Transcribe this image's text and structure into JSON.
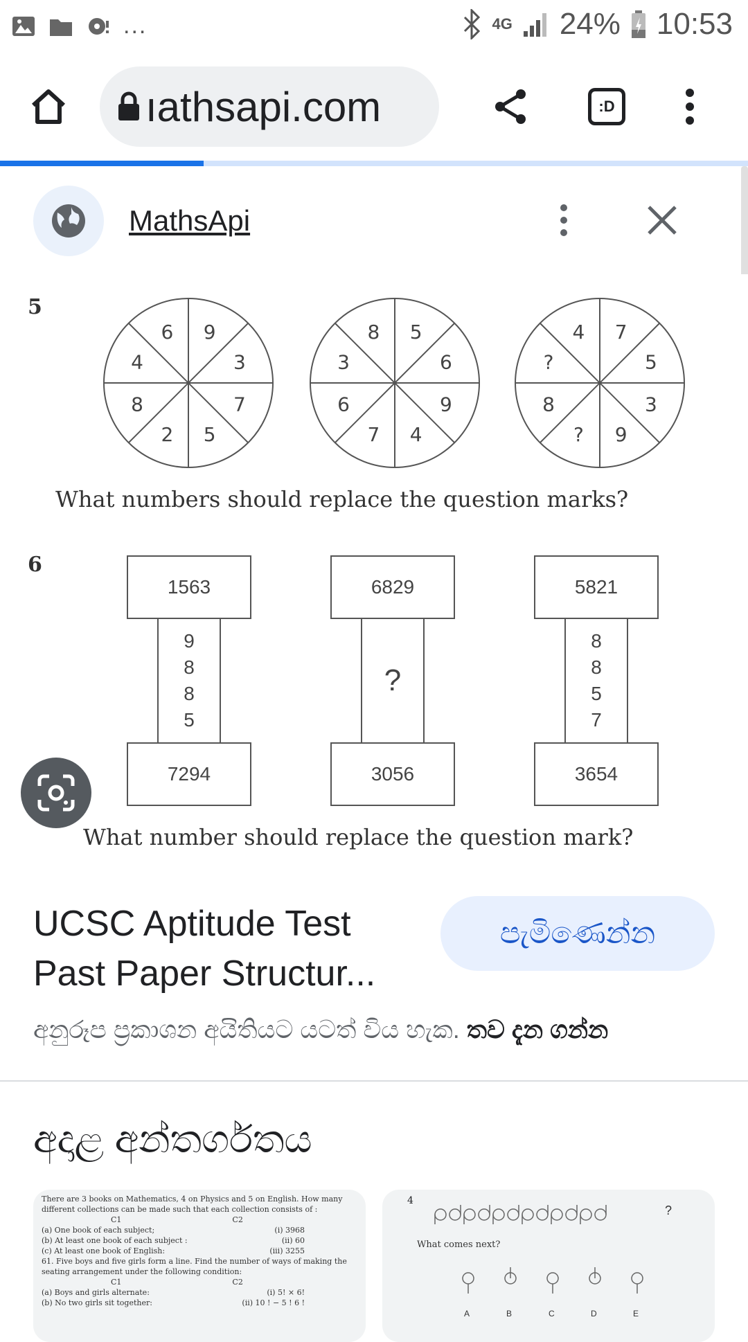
{
  "status_bar": {
    "left_dots": "...",
    "battery": "24%",
    "time": "10:53",
    "network": "4G"
  },
  "toolbar": {
    "url": "ıathsapi.com",
    "icons": [
      "home-icon",
      "lock-icon",
      "share-icon",
      "tab-switcher-icon",
      "more-vert-icon"
    ],
    "tab_label": ":D"
  },
  "sheet_header": {
    "site_name": "MathsApi",
    "icons": [
      "globe-icon",
      "more-vert-icon",
      "close-icon"
    ]
  },
  "puzzle_image": {
    "q5_number": "5",
    "q5_circles": [
      [
        "9",
        "3",
        "7",
        "5",
        "2",
        "8",
        "4",
        "6"
      ],
      [
        "5",
        "6",
        "9",
        "4",
        "7",
        "6",
        "3",
        "8"
      ],
      [
        "7",
        "5",
        "3",
        "9",
        "?",
        "8",
        "?",
        "4"
      ]
    ],
    "q5_text": "What numbers should replace the question marks?",
    "q6_number": "6",
    "q6_columns": [
      {
        "top": "1563",
        "middle": [
          "9",
          "8",
          "8",
          "5"
        ],
        "bottom": "7294"
      },
      {
        "top": "6829",
        "middle": [
          "?"
        ],
        "bottom": "3056"
      },
      {
        "top": "5821",
        "middle": [
          "8",
          "8",
          "5",
          "7"
        ],
        "bottom": "3654"
      }
    ],
    "q6_text": "What number should replace the question mark?"
  },
  "result": {
    "title": "UCSC Aptitude Test Past Paper Structur...",
    "visit_label": "පැමිණෙන්න",
    "notice": "අනුරූප ප්‍රකාශන අයිතියට යටත් විය හැක.",
    "learn_more": "තව දැන ගන්න"
  },
  "related": {
    "heading": "අදාළ අන්තර්ගතය",
    "card_1": {
      "lines": [
        "There are 3 books on Mathematics, 4 on Physics and 5 on English. How many",
        "different collections can be made such that each collection consists of :",
        "(a) One book of each subject;",
        "(b) At least one book of each subject :",
        "(c) At least one book of English:",
        "61. Five boys and five girls form a line. Find the number of ways of making the",
        "seating arrangement under the following condition:",
        "(a) Boys and girls alternate:",
        "(b) No two girls sit together:"
      ],
      "answers": [
        "(i) 3968",
        "(ii) 60",
        "(iii) 3255",
        "(i) 5! × 6!",
        "(ii) 10 ! − 5 ! 6 !"
      ],
      "col_head": "C1",
      "col_head_2": "C2"
    },
    "card_2": {
      "number": "4",
      "question": "What comes next?",
      "qmark": "?",
      "options": [
        "A",
        "B",
        "C",
        "D",
        "E"
      ]
    }
  },
  "colors": {
    "accent": "#1a73e8",
    "button_bg": "#e8f0fe",
    "button_text": "#1a56c8"
  }
}
